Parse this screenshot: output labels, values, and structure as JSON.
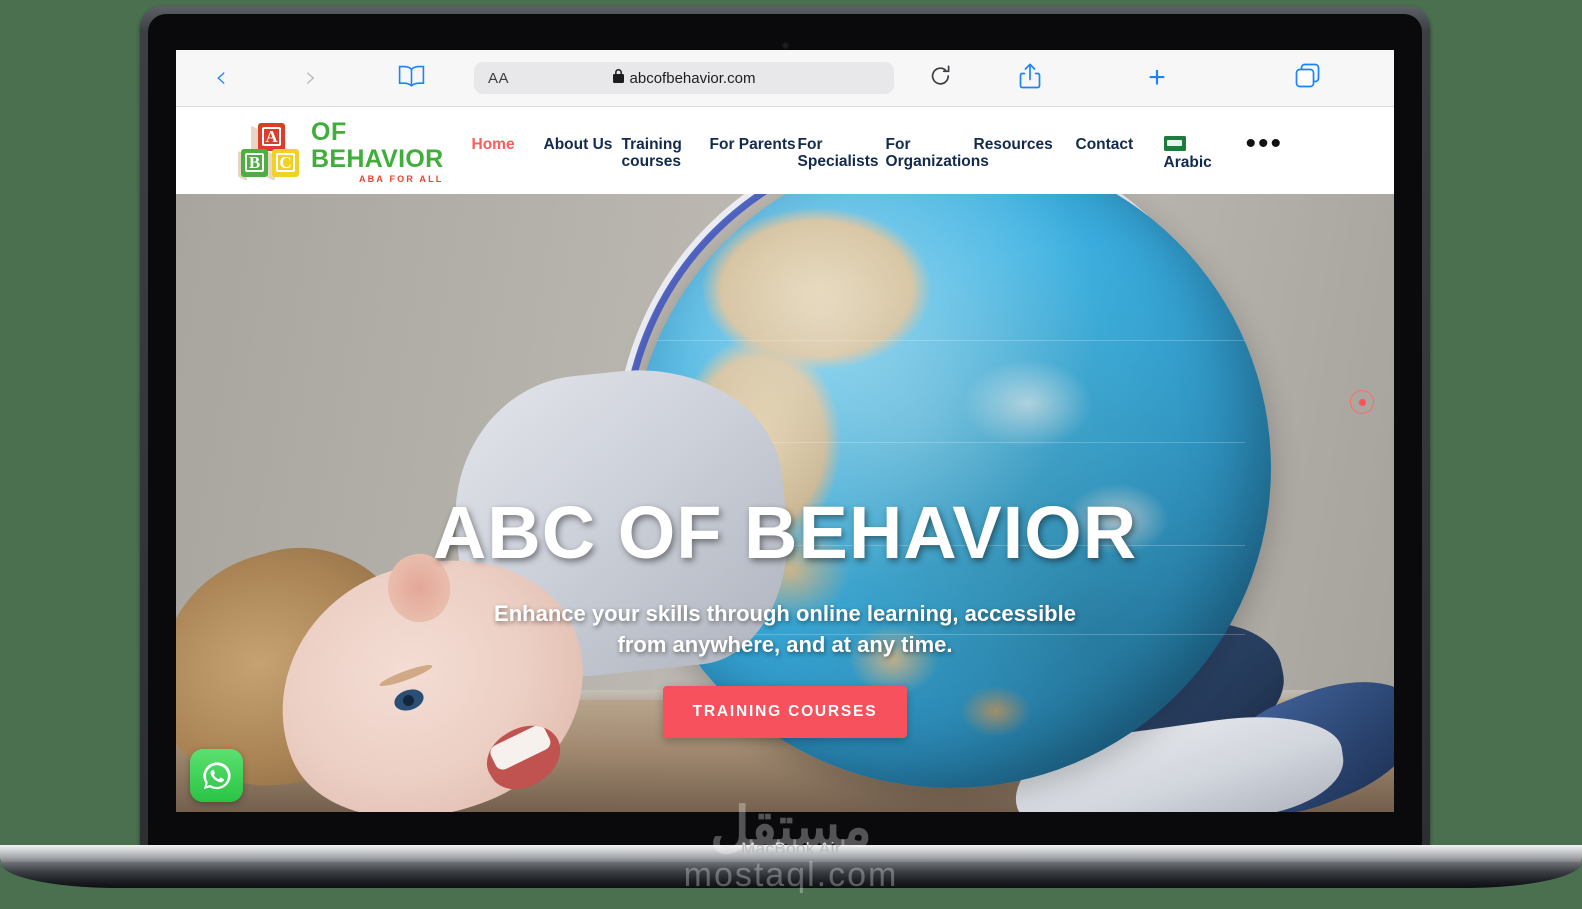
{
  "device": {
    "label": "MacBook Air",
    "background_color": "#4a7050"
  },
  "watermark": {
    "arabic": "مستقل",
    "url": "mostaql.com"
  },
  "browser": {
    "back_icon": "‹",
    "forward_icon": "›",
    "bookmarks_icon": "book-icon",
    "text_size_label": "AA",
    "lock_icon": "🔒",
    "url": "abcofbehavior.com",
    "reload_icon": "↻",
    "share_icon": "share-icon",
    "newtab_icon": "+",
    "tabs_icon": "tabs-icon"
  },
  "site": {
    "logo": {
      "block_a": "A",
      "block_b": "B",
      "block_c": "C",
      "line1": "OF",
      "line2": "BEHAVIOR",
      "tagline": "ABA FOR ALL",
      "green": "#3fae3a",
      "red": "#e8432f"
    },
    "nav": [
      {
        "label": "Home",
        "active": true
      },
      {
        "label": "About Us",
        "active": false
      },
      {
        "label": "Training courses",
        "active": false
      },
      {
        "label": "For Parents",
        "active": false
      },
      {
        "label": "For Specialists",
        "active": false
      },
      {
        "label": "For Organizations",
        "active": false
      },
      {
        "label": "Resources",
        "active": false
      },
      {
        "label": "Contact",
        "active": false
      }
    ],
    "language": {
      "label": "Arabic",
      "flag": "saudi-arabia-flag"
    },
    "more_menu": "•••",
    "active_color": "#ff5b5b",
    "nav_color": "#132a4f"
  },
  "hero": {
    "title": "ABC OF BEHAVIOR",
    "subtitle": "Enhance your skills through online learning, accessible from anywhere, and at any time.",
    "cta_label": "TRAINING COURSES",
    "cta_color": "#f7515e",
    "whatsapp_icon": "whatsapp-icon",
    "cursor_indicator": "cursor-dot-icon"
  }
}
